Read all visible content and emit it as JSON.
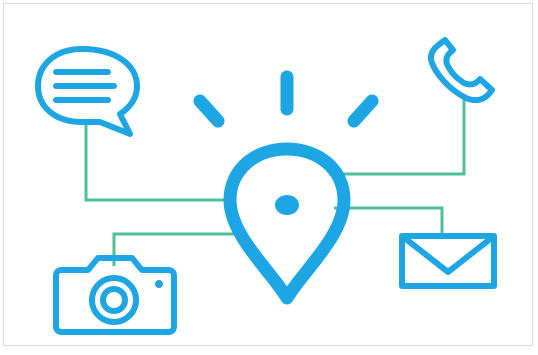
{
  "colors": {
    "icon": "#1ea6e4",
    "connector": "#4dbf9a",
    "background": "#ffffff",
    "frame_border": "#dcdcdc"
  },
  "nodes": [
    {
      "icon": "speech-bubble-icon"
    },
    {
      "icon": "phone-icon"
    },
    {
      "icon": "camera-icon"
    },
    {
      "icon": "envelope-icon"
    },
    {
      "icon": "location-pin-icon"
    }
  ]
}
